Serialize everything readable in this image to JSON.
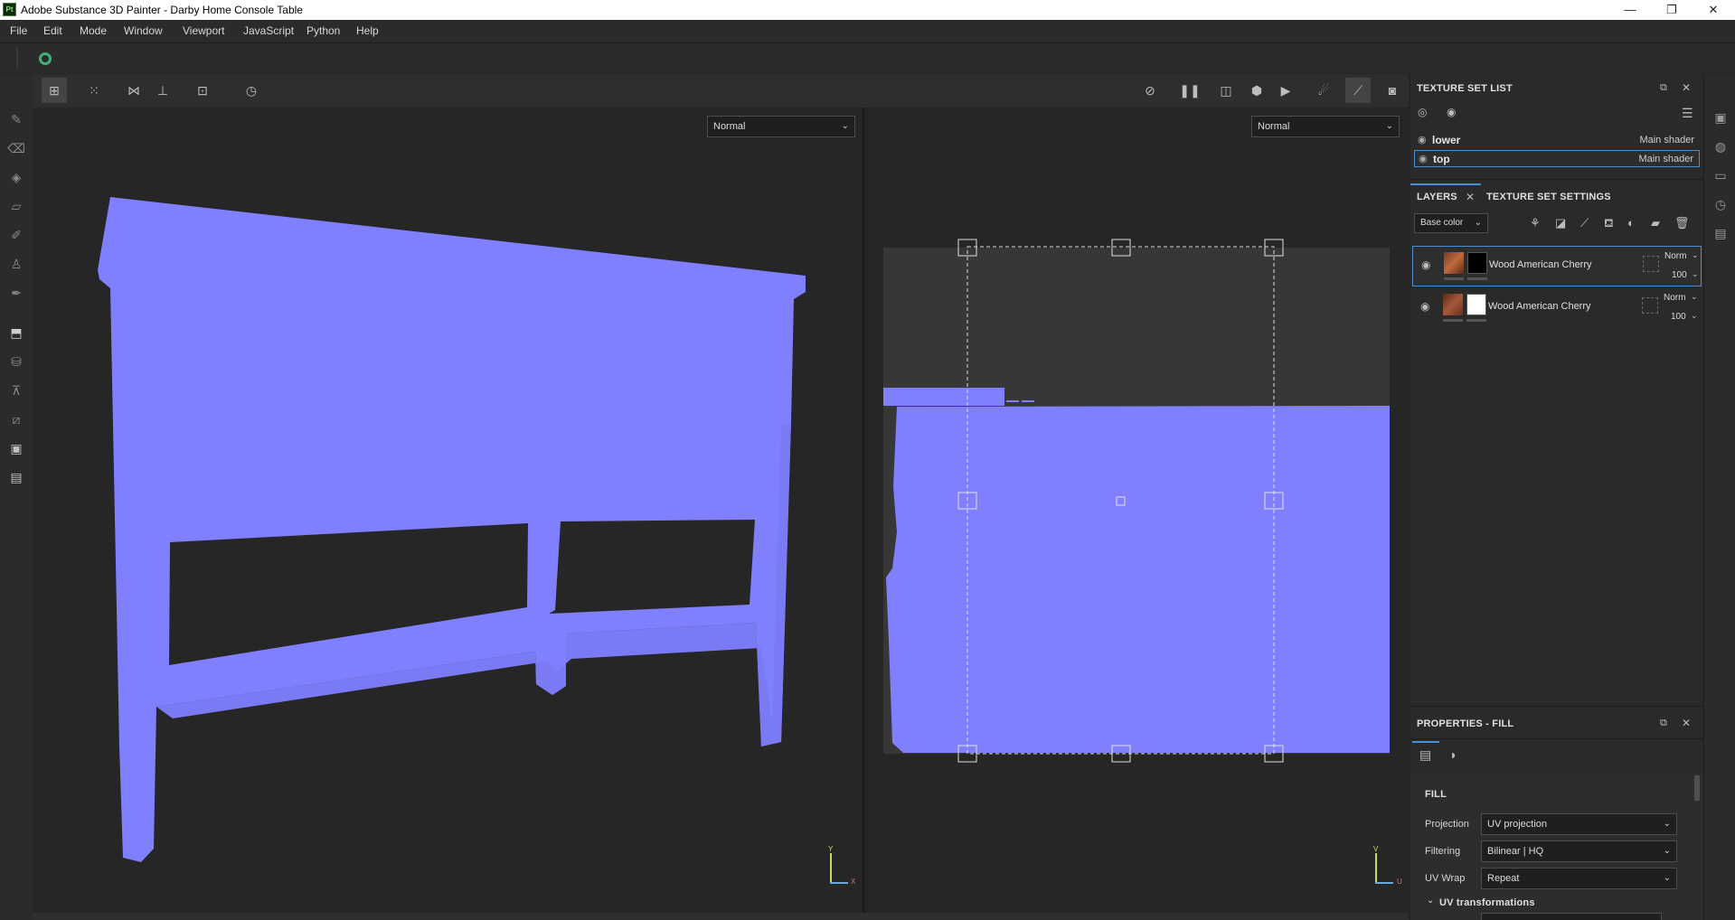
{
  "window": {
    "title": "Adobe Substance 3D Painter - Darby Home Console Table",
    "logo_text": "Pt",
    "controls": [
      "—",
      "❐",
      "✕"
    ]
  },
  "menu": [
    "File",
    "Edit",
    "Mode",
    "Window",
    "Viewport",
    "JavaScript",
    "Python",
    "Help"
  ],
  "viewport": {
    "left_mode": "Normal",
    "right_mode": "Normal",
    "axis_3d_y": "Y",
    "axis_3d_x": "X",
    "axis_2d_v": "V",
    "axis_2d_u": "U"
  },
  "texture_set_list": {
    "title": "TEXTURE SET LIST",
    "items": [
      {
        "name": "lower",
        "shader": "Main shader"
      },
      {
        "name": "top",
        "shader": "Main shader"
      }
    ]
  },
  "layers": {
    "tab_layers": "LAYERS",
    "tab_settings": "TEXTURE SET SETTINGS",
    "channel": "Base color",
    "items": [
      {
        "name": "Wood American Cherry",
        "blend": "Norm",
        "opacity": "100",
        "mask_color": "#000000"
      },
      {
        "name": "Wood American Cherry",
        "blend": "Norm",
        "opacity": "100",
        "mask_color": "#ffffff"
      }
    ]
  },
  "properties": {
    "title": "PROPERTIES - FILL",
    "section": "FILL",
    "rows": [
      {
        "label": "Projection",
        "value": "UV projection"
      },
      {
        "label": "Filtering",
        "value": "Bilinear | HQ"
      },
      {
        "label": "UV Wrap",
        "value": "Repeat"
      }
    ],
    "subsection": "UV transformations"
  },
  "colors": {
    "mesh": "#8080ff",
    "uv_bg": "#373737",
    "accent": "#4a8fd6"
  }
}
